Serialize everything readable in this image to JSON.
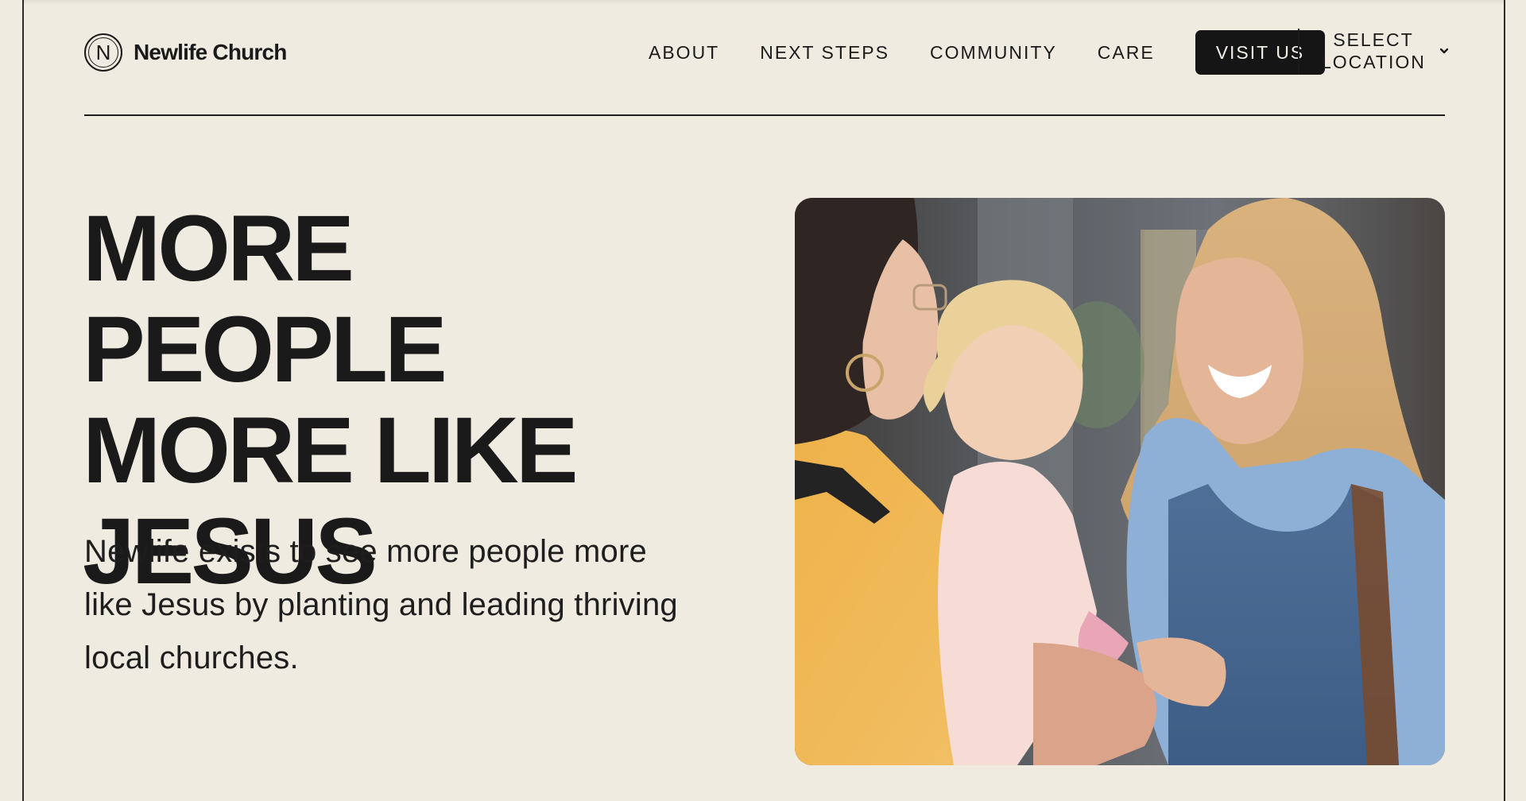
{
  "brand": {
    "logo_letter": "N",
    "name": "Newlife Church"
  },
  "nav": {
    "items": [
      {
        "label": "ABOUT"
      },
      {
        "label": "NEXT STEPS"
      },
      {
        "label": "COMMUNITY"
      },
      {
        "label": "CARE"
      }
    ],
    "visit_label": "VISIT US",
    "location_line1": "SELECT",
    "location_line2": "LOCATION",
    "location_icon": "chevron-down-icon"
  },
  "hero": {
    "title_lines": [
      "MORE PEOPLE",
      "MORE LIKE",
      "JESUS"
    ],
    "description": "Newlife exists to see more people more like Jesus by planting and leading thriving local churches."
  },
  "colors": {
    "background": "#efebe1",
    "text": "#1a1a1a",
    "button_bg": "#151515",
    "button_text": "#f3efe6"
  }
}
